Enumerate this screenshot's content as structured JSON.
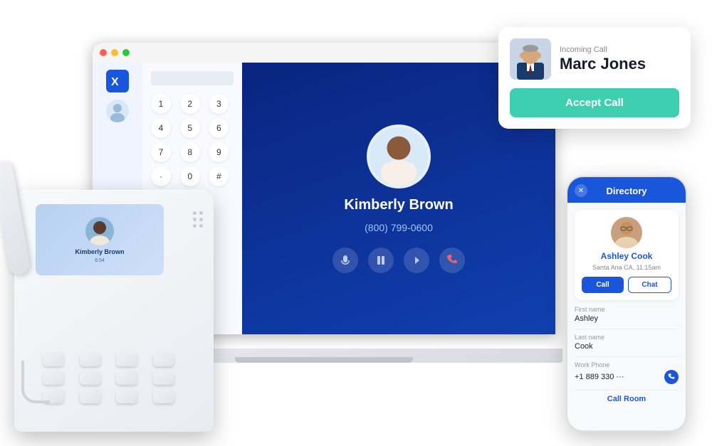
{
  "incomingCall": {
    "label": "Incoming Call",
    "callerName": "Marc Jones",
    "acceptLabel": "Accept Call"
  },
  "desktopApp": {
    "titleBar": {
      "dots": [
        "red",
        "yellow",
        "green"
      ]
    },
    "dialpad": {
      "keys": [
        "1",
        "2",
        "3",
        "4",
        "5",
        "6",
        "7",
        "8",
        "9",
        ".",
        "0",
        "#"
      ]
    },
    "activeCall": {
      "contactName": "Kimberly Brown",
      "phone": "(800) 799-0600"
    }
  },
  "deskPhone": {
    "contactName": "Kimberly Brown",
    "contactSub": "6:54"
  },
  "mobileApp": {
    "title": "Directory",
    "contactName": "Ashley Cook",
    "contactLocation": "Santa Ana CA, 11:15am",
    "callLabel": "Call",
    "chatLabel": "Chat",
    "fields": {
      "firstNameLabel": "First name",
      "firstName": "Ashley",
      "lastNameLabel": "Last name",
      "lastName": "Cook",
      "workPhoneLabel": "Work Phone",
      "workPhone": "+1 889 330 ···"
    },
    "callRoomLabel": "Call Room"
  }
}
